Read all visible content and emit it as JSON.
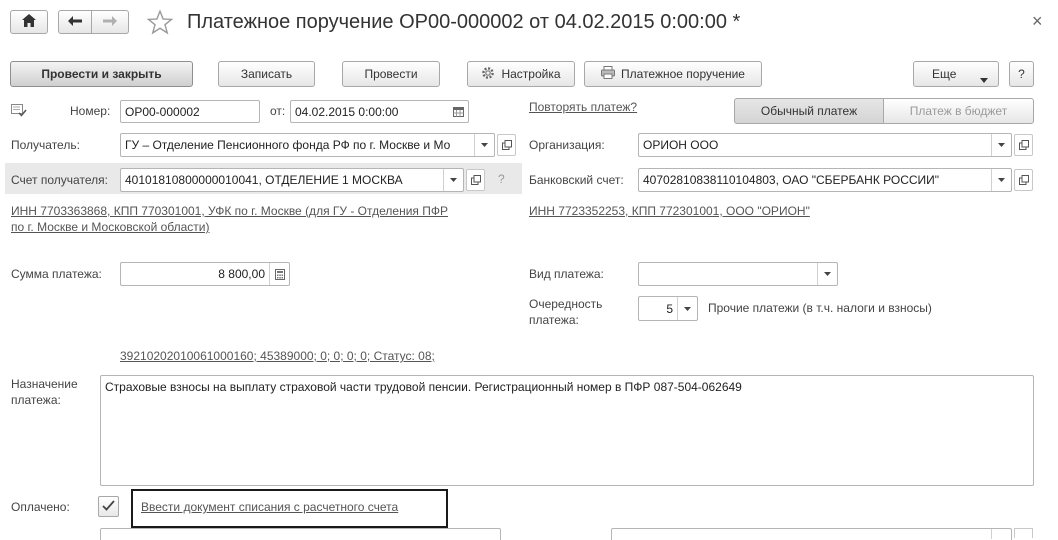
{
  "header": {
    "title": "Платежное поручение ОР00-000002 от 04.02.2015 0:00:00 *",
    "close_glyph": "×"
  },
  "toolbar": {
    "post_close": "Провести и закрыть",
    "save": "Записать",
    "post": "Провести",
    "settings": "Настройка",
    "print": "Платежное поручение",
    "more": "Еще",
    "help": "?"
  },
  "form": {
    "number_label": "Номер:",
    "number_value": "ОР00-000002",
    "from_label": "от:",
    "date_value": "04.02.2015  0:00:00",
    "repeat_link": "Повторять платеж?",
    "tab_normal": "Обычный платеж",
    "tab_budget": "Платеж в бюджет",
    "recipient_label": "Получатель:",
    "recipient_value": "ГУ – Отделение Пенсионного фонда РФ по г. Москве и Мо",
    "org_label": "Организация:",
    "org_value": "ОРИОН ООО",
    "recipient_account_label": "Счет получателя:",
    "recipient_account_value": "40101810800000010041, ОТДЕЛЕНИЕ 1 МОСКВА",
    "help_q": "?",
    "bank_account_label": "Банковский счет:",
    "bank_account_value": "40702810838110104803, ОАО \"СБЕРБАНК РОССИИ\"",
    "recipient_inn_line1": "ИНН 7703363868, КПП 770301001, УФК по г. Москве (для ГУ - Отделения ПФР",
    "recipient_inn_line2": "по г. Москве и Московской области)",
    "org_inn": "ИНН 7723352253, КПП 772301001, ООО \"ОРИОН\"",
    "amount_label": "Сумма платежа:",
    "amount_value": "8 800,00",
    "payment_type_label": "Вид платежа:",
    "payment_type_value": "",
    "priority_label_1": "Очередность",
    "priority_label_2": "платежа:",
    "priority_value": "5",
    "priority_desc": "Прочие платежи (в т.ч. налоги и взносы)",
    "budget_details_link": "39210202010061000160; 45389000; 0; 0; 0; 0; Статус: 08;",
    "purpose_label_1": "Назначение",
    "purpose_label_2": "платежа:",
    "purpose_value": "Страховые взносы на выплату страховой части трудовой пенсии. Регистрационный номер в ПФР 087-504-062649",
    "paid_label": "Оплачено:",
    "paid_checked": true,
    "writeoff_link": "Ввести документ списания с расчетного счета"
  },
  "icons": {
    "home": "home-icon",
    "back": "arrow-left-icon",
    "forward": "arrow-right-icon",
    "favorite": "star-icon",
    "settings": "gear-icon",
    "print": "printer-icon",
    "dropdown": "chevron-down-icon",
    "calendar": "calendar-icon",
    "calculator": "calculator-icon",
    "open": "open-icon",
    "document": "document-check-icon"
  }
}
